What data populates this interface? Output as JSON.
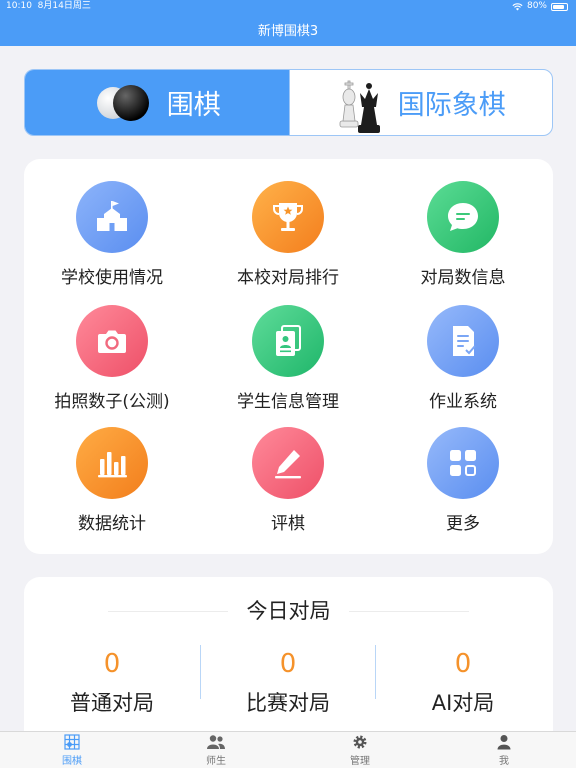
{
  "status": {
    "time": "10:10",
    "date": "8月14日周三",
    "battery": "80%"
  },
  "app_title": "新博围棋3",
  "segment": {
    "tabs": [
      {
        "label": "围棋"
      },
      {
        "label": "国际象棋"
      }
    ]
  },
  "grid": [
    {
      "label": "学校使用情况",
      "icon": "school-icon",
      "color": "#6f9ff5"
    },
    {
      "label": "本校对局排行",
      "icon": "trophy-icon",
      "color": "#f7952a"
    },
    {
      "label": "对局数信息",
      "icon": "chat-icon",
      "color": "#3cc97a"
    },
    {
      "label": "拍照数子(公测)",
      "icon": "camera-icon",
      "color": "#f16a7f"
    },
    {
      "label": "学生信息管理",
      "icon": "student-card-icon",
      "color": "#35c67f"
    },
    {
      "label": "作业系统",
      "icon": "homework-icon",
      "color": "#7ba6f5"
    },
    {
      "label": "数据统计",
      "icon": "bar-chart-icon",
      "color": "#f7902a"
    },
    {
      "label": "评棋",
      "icon": "pen-icon",
      "color": "#f16a7f"
    },
    {
      "label": "更多",
      "icon": "grid-more-icon",
      "color": "#7ba6f5"
    }
  ],
  "today": {
    "title": "今日对局",
    "stats": [
      {
        "value": "0",
        "label": "普通对局"
      },
      {
        "value": "0",
        "label": "比赛对局"
      },
      {
        "value": "0",
        "label": "AI对局"
      }
    ]
  },
  "tabbar": [
    {
      "label": "围棋",
      "icon": "board-icon",
      "active": true
    },
    {
      "label": "师生",
      "icon": "users-icon"
    },
    {
      "label": "管理",
      "icon": "gear-icon"
    },
    {
      "label": "我",
      "icon": "person-icon"
    }
  ]
}
